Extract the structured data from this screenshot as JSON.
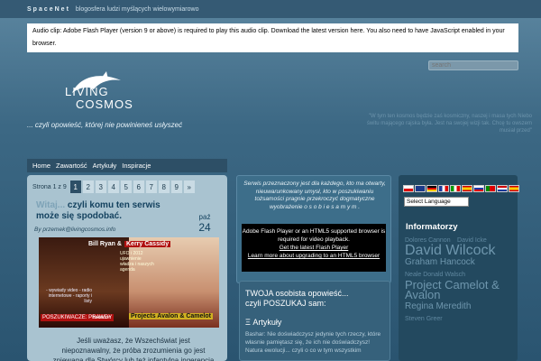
{
  "topbar": {
    "brand": "SpaceNet",
    "text": "blogosfera ludzi myślących wielowymiarowo"
  },
  "flash_notice": "Audio clip: Adobe Flash Player (version 9 or above) is required to play this audio clip. Download the latest version here. You also need to have JavaScript enabled in your browser.",
  "search": {
    "placeholder": "search"
  },
  "logo": {
    "line1": "LIVING",
    "line2": "COSMOS"
  },
  "tagline": "... czyli opowieść, której nie powinieneś usłyszeć",
  "right_quote": "\"W tym ten kosmos będzie zaś kosmiczny, naszej i masa tych Niebo świtu mającego rajska była. Jest na swojej wizji tak. Chcę tu owszem musiał przed\"",
  "nav": {
    "items": [
      "Home",
      "Zawartość",
      "Artykuły",
      "Inspiracje"
    ]
  },
  "pager": {
    "label": "Strona 1 z 9",
    "pages": [
      "1",
      "2",
      "3",
      "4",
      "5",
      "6",
      "7",
      "8",
      "9",
      "»"
    ],
    "active": "1"
  },
  "post": {
    "title_faded": "Witaj...",
    "title": "czyli komu ten serwis może się spodobać.",
    "date_month": "paź",
    "date_day": "24",
    "byline": "By przemek@livingcosmos.info",
    "image": {
      "name1": "Bill Ryan &",
      "name2": "Kerry Cassidy",
      "caption_top": "UFO i 2012 ujawnienie władza i naszych agenda",
      "caption_left": "- wywiady video - radio internetowe - raporty i listy",
      "banner": "POSZUKIWACZE: PRAWDY",
      "banner2": "badacze:",
      "banner3": "Projects Avalon & Camelot"
    },
    "excerpt": "Jeśli uważasz, że Wszechświat jest niepoznawalny, że próba zrozumienia go jest zniewagą dla Stwórcy lub też infantylną ingerencją"
  },
  "mid": {
    "quote": "Serwis przeznaczony jest dla każdego, kto ma otwarty, nieuwarunkowany umysł, kto w poszukiwaniu tożsamości pragnie przekroczyć dogmatyczne wyobrażenie o s o b i e s a m y m .",
    "flash_text": "Adobe Flash Player or an HTML5 supported browser is required for video playback.",
    "flash_link1": "Get the latest Flash Player",
    "flash_link2": "Learn more about upgrading to an HTML5 browser",
    "box_head": "TWOJA osobista opowieść...\nczyli POSZUKAJ sam:",
    "articles_head": "Ξ Artykuły",
    "articles": [
      "Bashar: Nie doświadczysz jedynie tych rzeczy, które własnie pamiętasz się, że ich nie doświadczysz!",
      "Natura ewolucji... czyli o co w tym wszystkim"
    ]
  },
  "right": {
    "flags": [
      "pl",
      "gb",
      "de",
      "fr",
      "it",
      "es",
      "ru",
      "pt",
      "nl",
      "es2"
    ],
    "language_select": "Select Language",
    "informatory_head": "Informatorzy",
    "cloud": [
      {
        "t": "Dolores Cannon"
      },
      {
        "t": "David Icke"
      },
      {
        "t": "David Wilcock"
      },
      {
        "t": "Graham Hancock"
      },
      {
        "t": "Neale Donald Walsch"
      },
      {
        "t": "Project Camelot & Avalon"
      },
      {
        "t": "Regina Meredith"
      },
      {
        "t": "Steven Greer"
      }
    ]
  },
  "colors": {
    "nav_bg": "#2d4f66",
    "content_bg": "#a9c3d0",
    "accent_red": "#b01010",
    "page_bg": "#3c6884"
  }
}
